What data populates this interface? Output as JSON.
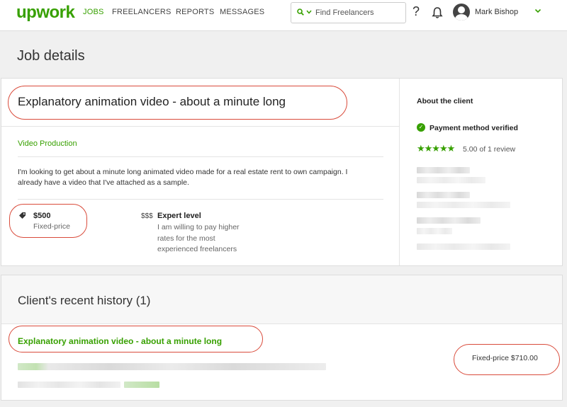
{
  "nav": {
    "logo": "upwork",
    "items": [
      {
        "label": "JOBS",
        "active": true
      },
      {
        "label": "FREELANCERS",
        "active": false
      },
      {
        "label": "REPORTS",
        "active": false
      },
      {
        "label": "MESSAGES",
        "active": false
      }
    ],
    "search_placeholder": "Find Freelancers",
    "help_glyph": "?",
    "user_name": "Mark Bishop"
  },
  "page": {
    "title": "Job details"
  },
  "job": {
    "title": "Explanatory animation video - about a minute long",
    "category": "Video Production",
    "description": "I'm looking to get about a minute long animated video made for a real estate rent to own campaign. I already have a video that I've attached as a sample.",
    "price": "$500",
    "price_type": "Fixed-price",
    "level_icon": "$$$",
    "level_title": "Expert level",
    "level_desc": "I am willing to pay higher rates for the most experienced freelancers"
  },
  "client": {
    "heading": "About the client",
    "verified": "Payment method verified",
    "stars": "★★★★★",
    "rating": "5.00 of 1 review"
  },
  "history": {
    "title": "Client's recent history (1)",
    "items": [
      {
        "title": "Explanatory animation video - about a minute long",
        "price": "Fixed-price $710.00"
      }
    ]
  },
  "colors": {
    "brand_green": "#37a000",
    "annotation_red": "#d94b3b"
  },
  "icons": {
    "search": "search-icon",
    "help": "help-icon",
    "notifications": "bell-icon",
    "price_tag": "tag-icon",
    "verified": "check-circle-icon",
    "dropdown": "chevron-down-icon"
  }
}
